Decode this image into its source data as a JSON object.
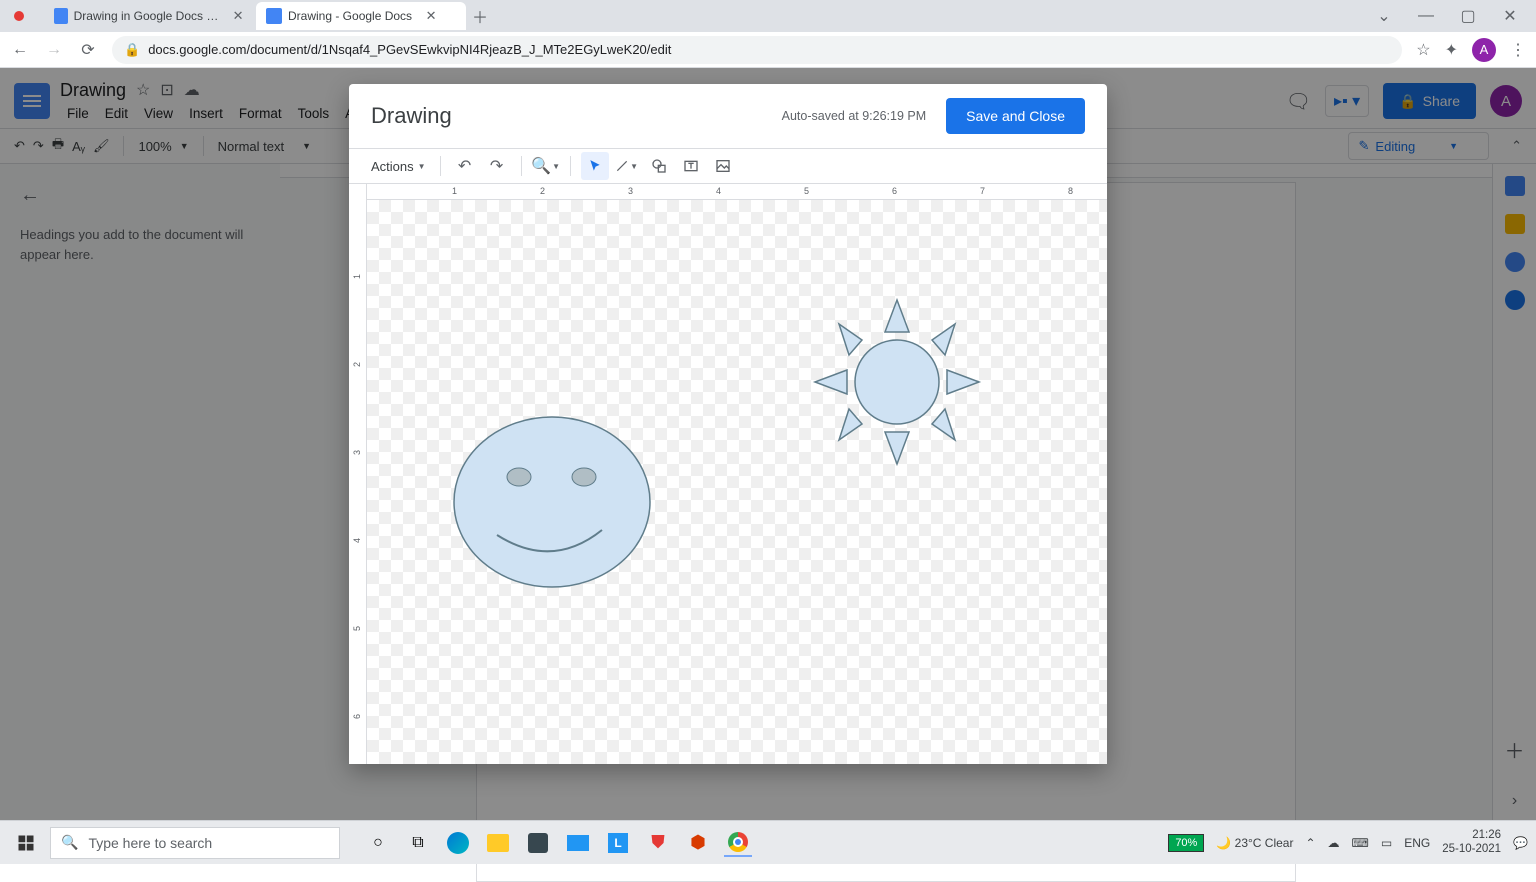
{
  "browser": {
    "tabs": [
      {
        "title": "",
        "active": false,
        "red_dot": true
      },
      {
        "title": "Drawing in Google Docs - Googl",
        "active": false
      },
      {
        "title": "Drawing - Google Docs",
        "active": true
      }
    ],
    "url": "docs.google.com/document/d/1Nsqaf4_PGevSEwkvipNI4RjeazB_J_MTe2EGyLweK20/edit",
    "avatar_letter": "A"
  },
  "docs": {
    "title": "Drawing",
    "menus": [
      "File",
      "Edit",
      "View",
      "Insert",
      "Format",
      "Tools",
      "Ad"
    ],
    "zoom": "100%",
    "style_select": "Normal text",
    "editing_label": "Editing",
    "share_label": "Share",
    "outline_hint": "Headings you add to the document will appear here.",
    "avatar_letter": "A"
  },
  "modal": {
    "title": "Drawing",
    "autosave": "Auto-saved at 9:26:19 PM",
    "save_close": "Save and Close",
    "actions_label": "Actions",
    "h_ruler": [
      "1",
      "2",
      "3",
      "4",
      "5",
      "6",
      "7",
      "8"
    ],
    "v_ruler": [
      "1",
      "2",
      "3",
      "4",
      "5",
      "6"
    ]
  },
  "taskbar": {
    "search_placeholder": "Type here to search",
    "battery": "70%",
    "weather": "23°C Clear",
    "lang": "ENG",
    "time": "21:26",
    "date": "25-10-2021"
  }
}
